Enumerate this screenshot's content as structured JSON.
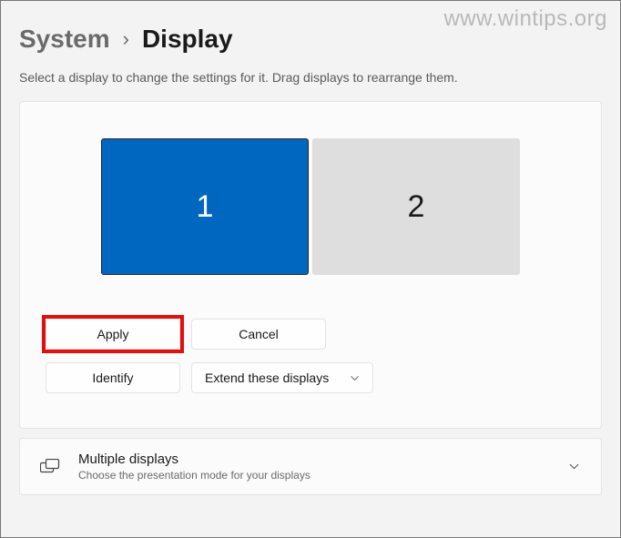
{
  "watermark": "www.wintips.org",
  "breadcrumb": {
    "parent": "System",
    "current": "Display"
  },
  "hint": "Select a display to change the settings for it. Drag displays to rearrange them.",
  "monitors": {
    "m1": "1",
    "m2": "2"
  },
  "buttons": {
    "apply": "Apply",
    "cancel": "Cancel",
    "identify": "Identify"
  },
  "dropdown": {
    "label": "Extend these displays"
  },
  "multi": {
    "title": "Multiple displays",
    "subtitle": "Choose the presentation mode for your displays"
  }
}
